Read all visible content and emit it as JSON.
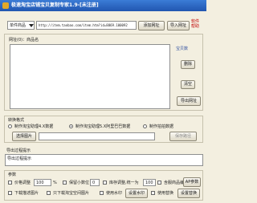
{
  "window": {
    "title": "极速淘宝店铺宝贝复制专家1.9-[未注册]"
  },
  "source": {
    "select_value": "单件商品",
    "url_value": "http://item.taobao.com/item.htm?id=8869.100092",
    "add_button": "添加网址",
    "import_button": "导入网址",
    "software_help": "软件帮助"
  },
  "url_list": {
    "header": "网址(0)：商品名",
    "baby_count_label": "宝贝数",
    "delete_button": "删除",
    "clear_button": "清空",
    "export_button": "导出网址",
    "url_value": "http://item.taobao.com/item.htm?id=8869.100092"
  },
  "convert": {
    "label": "转换格式",
    "options": [
      "制作淘宝助理4.X数据",
      "制作淘宝助理5.X阿里巴巴数据",
      "制作拍拍数据"
    ],
    "selected_index": 1,
    "select_images_button": "选择图片",
    "save_path_button": "保存路径"
  },
  "export_log": {
    "label": "导出过程提示",
    "line": "导出过程提示"
  },
  "params": {
    "label": "参数",
    "price_adjust": "价格调整",
    "price_value": "100",
    "percent": "%",
    "keep_decimal": "保留小数位",
    "decimal_value": "0",
    "stock_adjust": "库存调整,统一为",
    "stock_value": "100",
    "contains_product_code": "含服商品编码",
    "download_images": "下载描述图片",
    "only_download_images": "只下载淘宝空间图片",
    "use_watermark": "使用水印",
    "set_watermark": "设置水印",
    "use_replace": "使用替换",
    "set_replace": "设置替换",
    "ap_params": "AP参数"
  }
}
